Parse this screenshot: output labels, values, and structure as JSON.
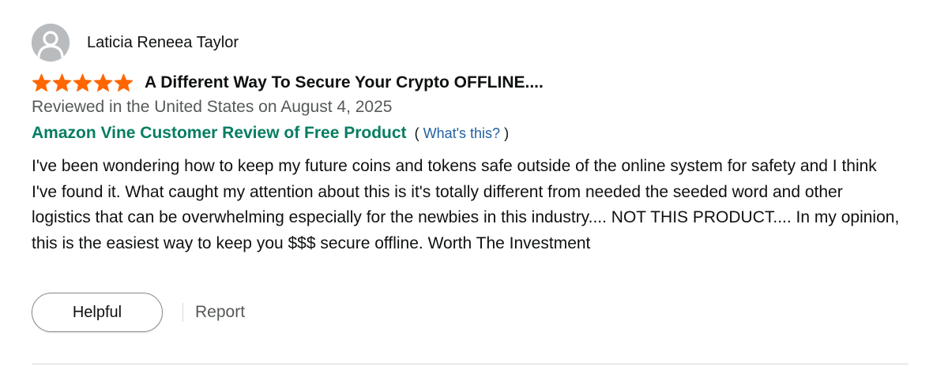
{
  "reviewer": {
    "name": "Laticia Reneea Taylor",
    "avatar_icon": "default-user-avatar-icon"
  },
  "review": {
    "rating": 5,
    "rating_max": 5,
    "star_color": "#ff6600",
    "title": "A Different Way To Secure Your Crypto OFFLINE....",
    "date_text": "Reviewed in the United States on August 4, 2025",
    "vine_label": "Amazon Vine Customer Review of Free Product",
    "vine_help_open": "(",
    "vine_help_link": "What's this?",
    "vine_help_close": ")",
    "body": "I've been wondering how to keep my future coins and tokens safe outside of the online system for safety and I think I've found it. What caught my attention about this is it's totally different from needed the seeded word and other logistics that can be overwhelming especially for the newbies in this industry.... NOT THIS PRODUCT.... In my opinion, this is the easiest way to keep you $$$ secure offline. Worth The Investment"
  },
  "actions": {
    "helpful_label": "Helpful",
    "report_label": "Report"
  },
  "colors": {
    "vine_green": "#067d62",
    "link_blue": "#2162a1",
    "muted_text": "#565959"
  }
}
